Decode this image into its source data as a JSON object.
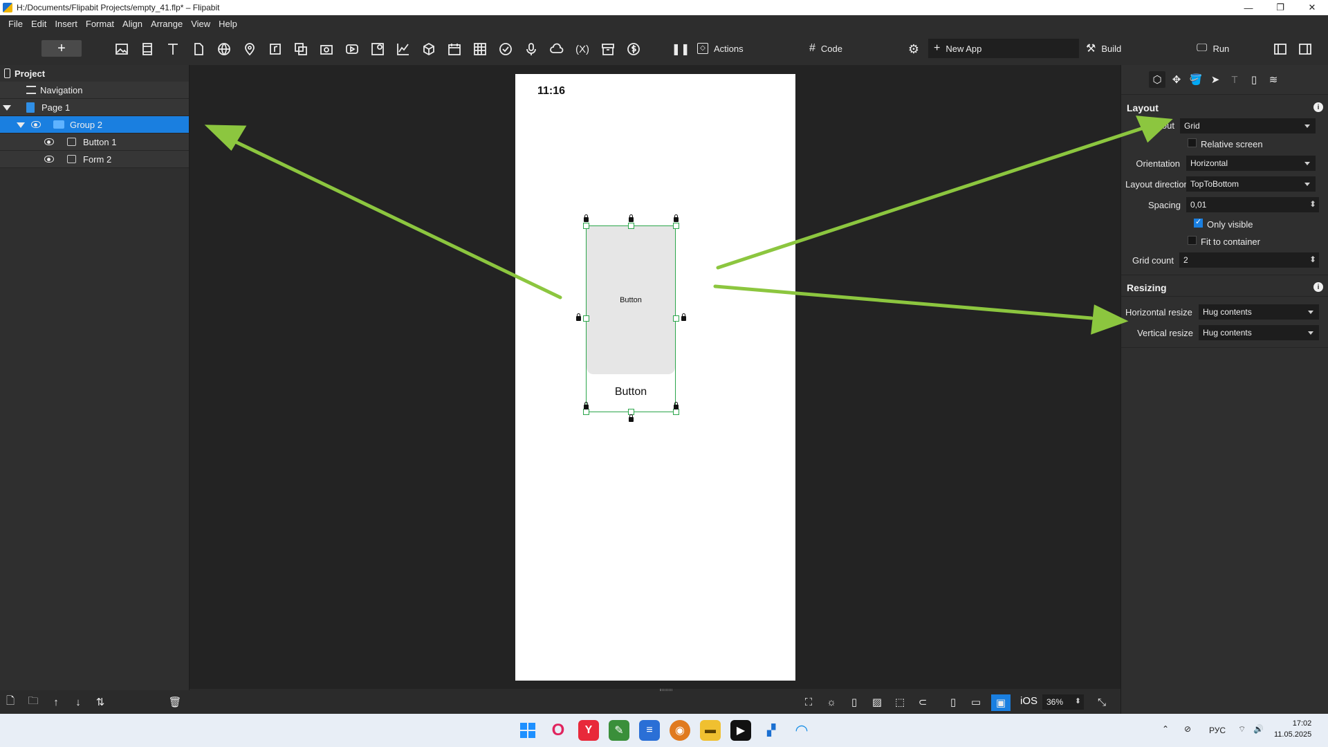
{
  "window": {
    "title": "H:/Documents/Flipabit Projects/empty_41.flp* – Flipabit"
  },
  "menu": [
    "File",
    "Edit",
    "Insert",
    "Format",
    "Align",
    "Arrange",
    "View",
    "Help"
  ],
  "toolbar": {
    "add_label": "+",
    "actions_label": "Actions",
    "code_label": "Code",
    "new_app_label": "New App",
    "build_label": "Build",
    "run_label": "Run"
  },
  "project": {
    "header": "Project",
    "tree": [
      {
        "label": "Navigation"
      },
      {
        "label": "Page 1"
      },
      {
        "label": "Group 2"
      },
      {
        "label": "Button 1"
      },
      {
        "label": "Form 2"
      }
    ]
  },
  "canvas": {
    "time": "11:16",
    "grey_button_text": "Button",
    "text_button_text": "Button",
    "platform": "iOS",
    "zoom": "36%"
  },
  "layout_section": {
    "title": "Layout",
    "layout_label": "Layout",
    "layout_value": "Grid",
    "relative_screen": "Relative screen",
    "orientation_label": "Orientation",
    "orientation_value": "Horizontal",
    "direction_label": "Layout direction",
    "direction_value": "TopToBottom",
    "spacing_label": "Spacing",
    "spacing_value": "0,01",
    "only_visible": "Only visible",
    "fit_container": "Fit to container",
    "grid_count_label": "Grid count",
    "grid_count_value": "2"
  },
  "resizing_section": {
    "title": "Resizing",
    "h_label": "Horizontal resize",
    "h_value": "Hug contents",
    "v_label": "Vertical resize",
    "v_value": "Hug contents"
  },
  "taskbar": {
    "lang": "РУС",
    "time": "17:02",
    "date": "11.05.2025"
  },
  "colors": {
    "selection": "#1a7fe0",
    "selection_box": "#2aa54a",
    "annotation_arrow": "#8cc63f"
  }
}
